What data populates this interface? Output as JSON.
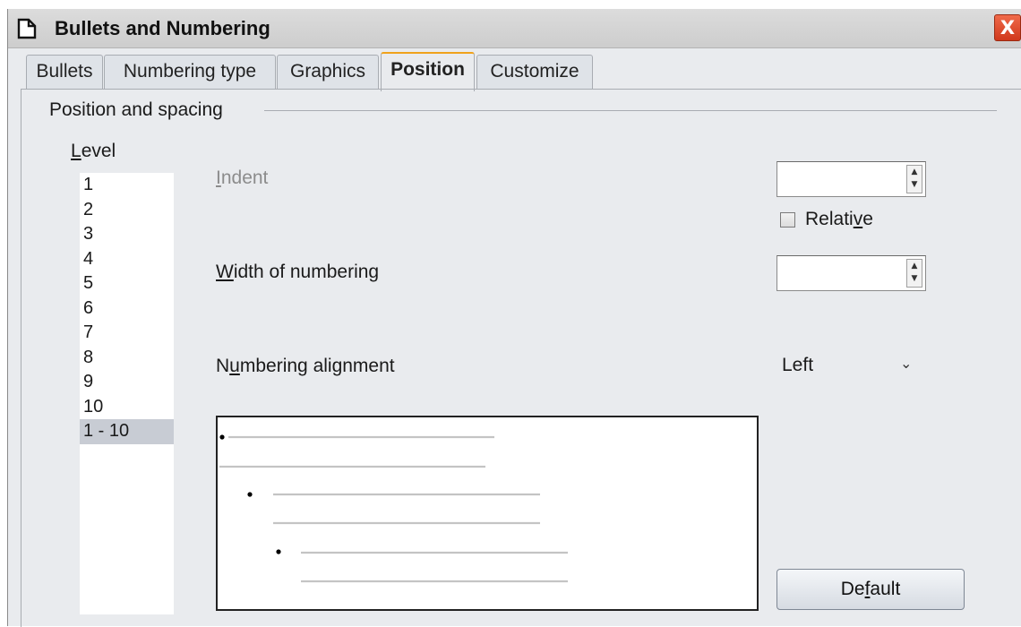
{
  "window": {
    "title": "Bullets and Numbering",
    "close_label": "X"
  },
  "tabs": [
    {
      "label": "Bullets"
    },
    {
      "label": "Numbering type"
    },
    {
      "label": "Graphics"
    },
    {
      "label": "Position",
      "active": true
    },
    {
      "label": "Customize"
    }
  ],
  "position_spacing": {
    "group_label": "Position and spacing",
    "level_label": "Level",
    "levels": [
      "1",
      "2",
      "3",
      "4",
      "5",
      "6",
      "7",
      "8",
      "9",
      "10",
      "1 - 10"
    ],
    "selected_level": "1 - 10",
    "indent": {
      "label": "Indent",
      "value": "",
      "enabled": false
    },
    "relative": {
      "label": "Relative",
      "checked": false
    },
    "width_of_numbering": {
      "label": "Width of numbering",
      "value": ""
    },
    "numbering_alignment": {
      "label": "Numbering alignment",
      "value": "Left"
    }
  },
  "buttons": {
    "default_label": "Default"
  },
  "colors": {
    "dialog_bg": "#e9ebee",
    "active_tab_accent": "#f0a21c",
    "close_button": "#d0381b",
    "selected_row": "#c8ccd4"
  }
}
